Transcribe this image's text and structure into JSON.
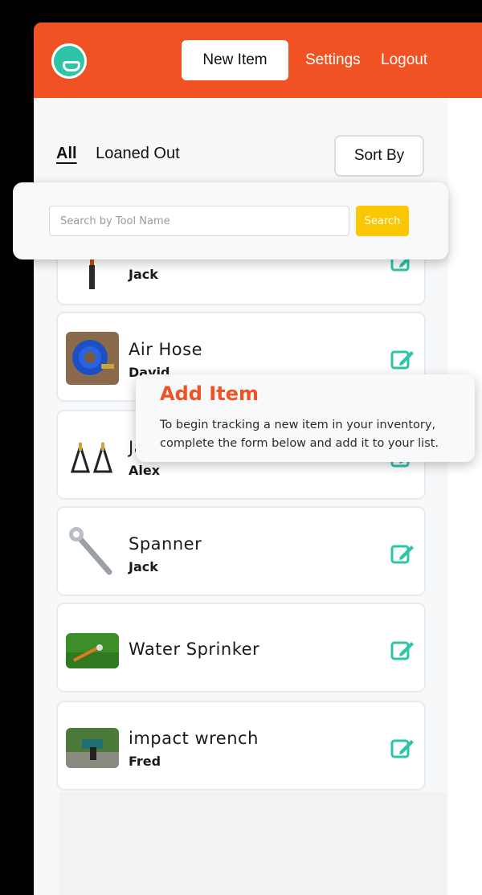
{
  "header": {
    "new_item_label": "New Item",
    "settings_label": "Settings",
    "logout_label": "Logout",
    "brand_color": "#f05223",
    "logo_color": "#2ec4a7"
  },
  "filters": {
    "all_label": "All",
    "loaned_label": "Loaned Out",
    "sort_label": "Sort By"
  },
  "search": {
    "placeholder": "Search by Tool Name",
    "button_label": "Search",
    "button_color": "#fbc704"
  },
  "tools": [
    {
      "name": "",
      "owner": "Jack",
      "image": "hammer"
    },
    {
      "name": "Air Hose",
      "owner": "David",
      "image": "air-hose"
    },
    {
      "name": "Ja",
      "owner": "Alex",
      "image": "jack-stands"
    },
    {
      "name": "Spanner",
      "owner": "Jack",
      "image": "spanner"
    },
    {
      "name": "Water Sprinker",
      "owner": "",
      "image": "sprinkler"
    },
    {
      "name": "impact wrench",
      "owner": "Fred",
      "image": "impact-wrench"
    }
  ],
  "tooltip": {
    "title": "Add Item",
    "body": "To begin tracking a new item in your inventory, complete the form below and add it to your list."
  },
  "icons": {
    "edit": "edit-icon",
    "edit_color": "#2ec4a7"
  }
}
